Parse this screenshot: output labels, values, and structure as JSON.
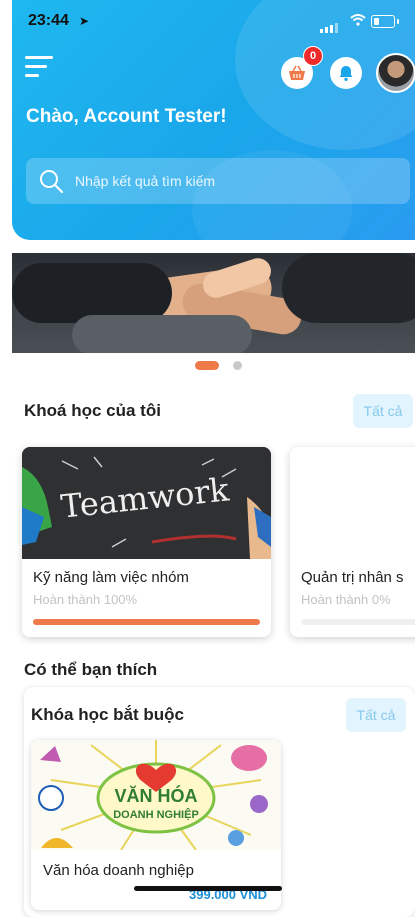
{
  "status_bar": {
    "time": "23:44"
  },
  "header": {
    "greeting": "Chào, Account Tester!",
    "cart_badge": "0",
    "search_placeholder": "Nhập kết quả tìm kiếm"
  },
  "my_courses": {
    "title": "Khoá học của tôi",
    "all_label": "Tất cả",
    "items": [
      {
        "title": "Kỹ năng làm việc nhóm",
        "status": "Hoàn thành 100%",
        "progress": 1.0,
        "thumb_text": "Teamwork"
      },
      {
        "title": "Quản trị nhân s",
        "status": "Hoàn thành 0%",
        "progress": 0.0
      }
    ]
  },
  "suggested": {
    "title": "Có thể bạn thích",
    "group_title": "Khóa học bắt buộc",
    "all_label": "Tất cả",
    "items": [
      {
        "title": "Văn hóa doanh nghiệp",
        "price": "399.000 VND",
        "logo_line1": "VĂN HÓA",
        "logo_line2": "DOANH NGHIỆP"
      }
    ]
  },
  "colors": {
    "accent": "#1aa6ea",
    "progress": "#ee7a4a",
    "badge": "#ef2b2b"
  }
}
